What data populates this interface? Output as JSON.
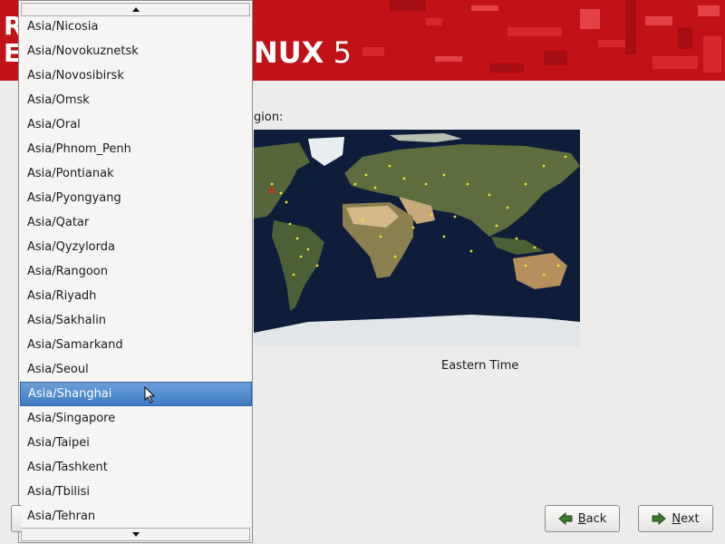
{
  "header": {
    "left_letters": [
      "R",
      "E"
    ],
    "title_bold": "NUX",
    "title_version": "5"
  },
  "region_prompt": "gion:",
  "timezone_label": "Eastern Time",
  "timezone_list": {
    "items": [
      "Asia/Nicosia",
      "Asia/Novokuznetsk",
      "Asia/Novosibirsk",
      "Asia/Omsk",
      "Asia/Oral",
      "Asia/Phnom_Penh",
      "Asia/Pontianak",
      "Asia/Pyongyang",
      "Asia/Qatar",
      "Asia/Qyzylorda",
      "Asia/Rangoon",
      "Asia/Riyadh",
      "Asia/Sakhalin",
      "Asia/Samarkand",
      "Asia/Seoul",
      "Asia/Shanghai",
      "Asia/Singapore",
      "Asia/Taipei",
      "Asia/Tashkent",
      "Asia/Tbilisi",
      "Asia/Tehran"
    ],
    "selected": "Asia/Shanghai"
  },
  "buttons": {
    "back_label_accel": "B",
    "back_label_rest": "ack",
    "next_label_accel": "N",
    "next_label_rest": "ext"
  },
  "icons": {
    "scroll_up": "triangle-up-icon",
    "scroll_down": "triangle-down-icon",
    "back": "arrow-left-icon",
    "next": "arrow-right-icon",
    "cursor": "mouse-pointer-icon"
  },
  "colors": {
    "header_red": "#c11217",
    "selection_blue": "#3f7cc4",
    "map_ocean": "#0d1d3a",
    "city_dot": "#f0e52a",
    "selected_city": "#e02020"
  }
}
